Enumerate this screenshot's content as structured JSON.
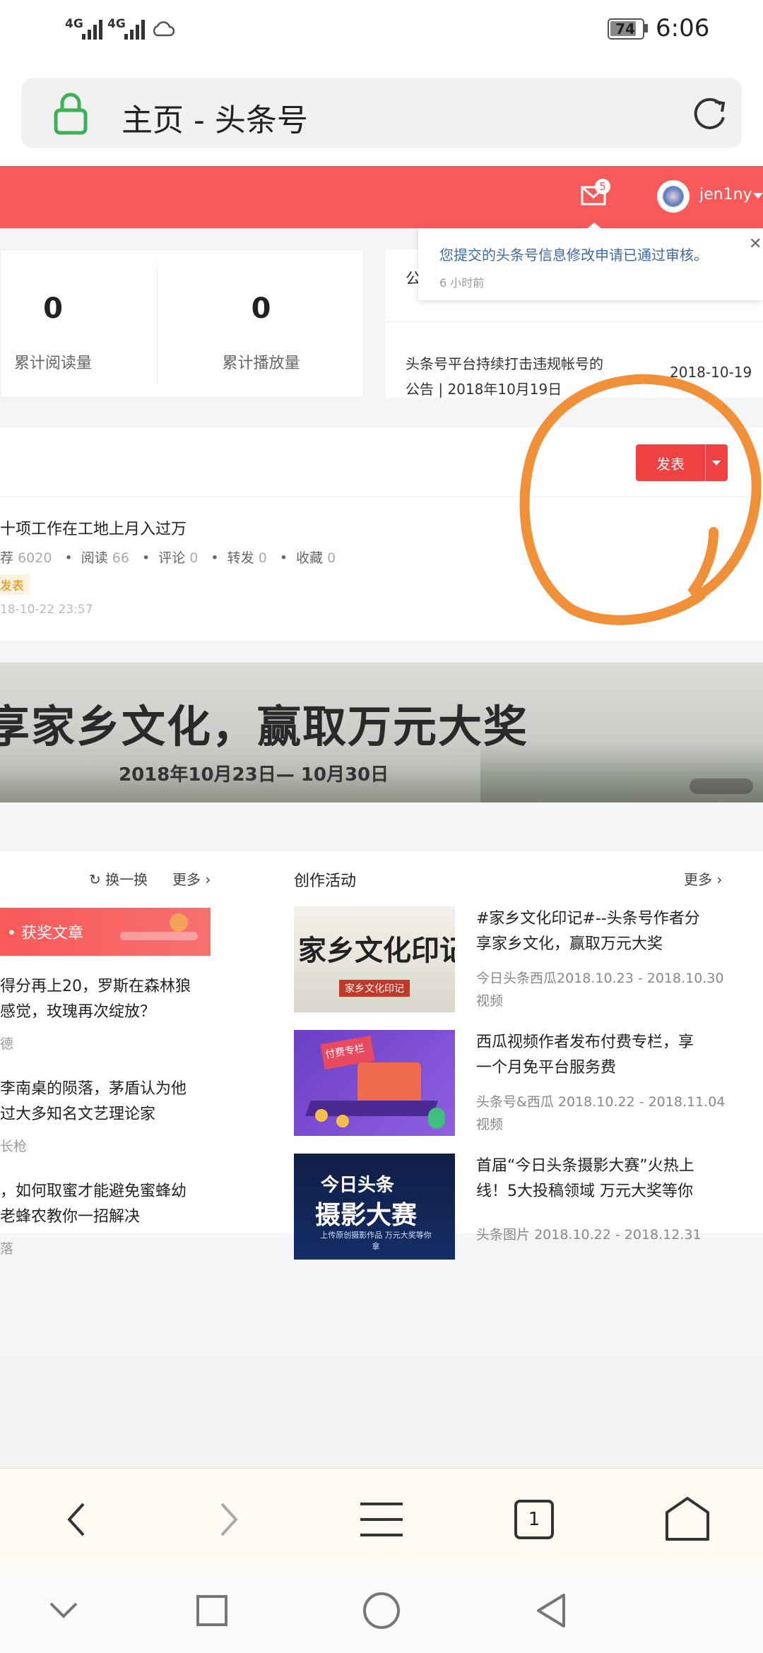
{
  "status": {
    "network1": "4G",
    "network2": "4G",
    "battery": "74",
    "time": "6:06"
  },
  "browser": {
    "url_title": "主页 - 头条号",
    "tab_count": "1"
  },
  "header": {
    "mail_badge": "5",
    "username": "jen1ny"
  },
  "notification": {
    "text": "您提交的头条号信息修改申请已通过审核。",
    "time": "6 小时前"
  },
  "stats": [
    {
      "value": "0",
      "label": "累计阅读量"
    },
    {
      "value": "0",
      "label": "累计播放量"
    }
  ],
  "announcement": {
    "header_char": "公",
    "title_line1": "头条号平台持续打击违规帐号的",
    "title_line2": "公告 | 2018年10月19日",
    "date": "2018-10-19"
  },
  "publish": {
    "button_label": "发表"
  },
  "article": {
    "title": "十项工作在工地上月入过万",
    "recommend_label": "荐",
    "recommend": "6020",
    "read_label": "阅读",
    "read": "66",
    "comment_label": "评论",
    "comment": "0",
    "share_label": "转发",
    "share": "0",
    "fav_label": "收藏",
    "fav": "0",
    "status": "发表",
    "time": "18-10-22 23:57"
  },
  "banner": {
    "title": "享家乡文化，赢取万元大奖",
    "dates": "2018年10月23日— 10月30日"
  },
  "left_panel": {
    "refresh_label": "换一换",
    "more_label": "更多",
    "award_label": "获奖文章",
    "items": [
      {
        "line1": "得分再上20，罗斯在森林狼",
        "line2": "感觉，玫瑰再次绽放？",
        "author": "德"
      },
      {
        "line1": "李南桌的陨落，茅盾认为他",
        "line2": "过大多知名文艺理论家",
        "author": "长枪"
      },
      {
        "line1": "，如何取蜜才能避免蜜蜂幼",
        "line2": "老蜂农教你一招解决",
        "author": "落"
      }
    ]
  },
  "activities": {
    "title": "创作活动",
    "more_label": "更多",
    "items": [
      {
        "thumb_text": "家乡文化印记",
        "thumb_sub": "家乡文化印记",
        "line1": "#家乡文化印记#--头条号作者分",
        "line2": "享家乡文化，赢取万元大奖",
        "source": "今日头条西瓜",
        "dates": "2018.10.23 - 2018.10.30",
        "extra": "视频"
      },
      {
        "thumb_text": "付费专栏",
        "thumb_sub": "",
        "line1": "西瓜视频作者发布付费专栏，享",
        "line2": "一个月免平台服务费",
        "source": "头条号&西瓜",
        "dates": "2018.10.22 - 2018.11.04",
        "extra": "视频"
      },
      {
        "thumb_text": "今日头条",
        "thumb_sub": "摄影大赛",
        "thumb_sub2": "上传原创摄影作品 万元大奖等你拿",
        "line1": "首届“今日头条摄影大赛”火热上",
        "line2": "线！5大投稿领域 万元大奖等你",
        "source": "头条图片",
        "dates": "2018.10.22 - 2018.12.31",
        "extra": ""
      }
    ]
  },
  "colors": {
    "brand_red": "#f85959",
    "annotation_orange": "#f0913a"
  }
}
